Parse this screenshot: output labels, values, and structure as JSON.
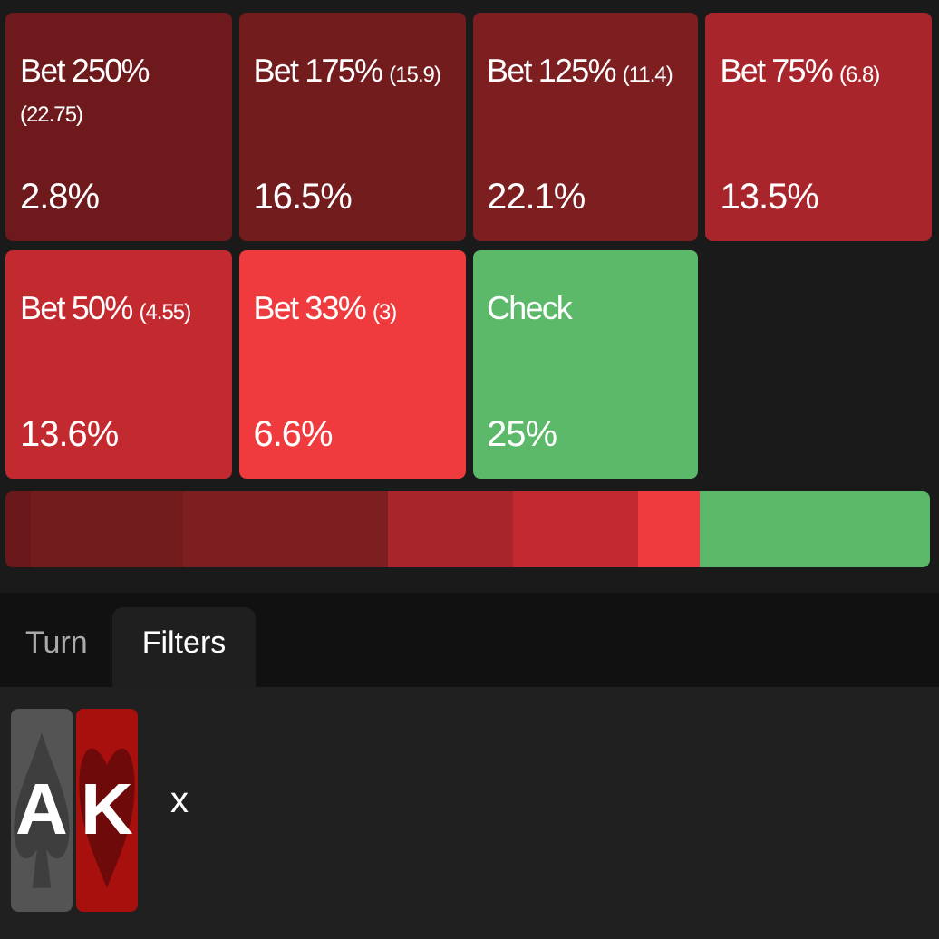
{
  "actions": [
    {
      "label": "Bet 250%",
      "sub": "(22.75)",
      "percent": "2.8%",
      "color": "#6e1a1c",
      "wrap": true
    },
    {
      "label": "Bet 175%",
      "sub": "(15.9)",
      "percent": "16.5%",
      "color": "#721c1e",
      "wrap": false
    },
    {
      "label": "Bet 125%",
      "sub": "(11.4)",
      "percent": "22.1%",
      "color": "#7d1f21",
      "wrap": false
    },
    {
      "label": "Bet 75%",
      "sub": "(6.8)",
      "percent": "13.5%",
      "color": "#a8262b",
      "wrap": false
    },
    {
      "label": "Bet 50%",
      "sub": "(4.55)",
      "percent": "13.6%",
      "color": "#c32a30",
      "wrap": false
    },
    {
      "label": "Bet 33%",
      "sub": "(3)",
      "percent": "6.6%",
      "color": "#ef3b3e",
      "wrap": false
    },
    {
      "label": "Check",
      "percent": "25%",
      "color": "#5cb96a",
      "wrap": false
    }
  ],
  "tabs": [
    {
      "label": "Turn",
      "selected": false
    },
    {
      "label": "Filters",
      "selected": true
    }
  ],
  "filter": {
    "cards": [
      {
        "rank": "A",
        "kind": "spade"
      },
      {
        "rank": "K",
        "kind": "heart"
      }
    ],
    "remove": "x"
  }
}
